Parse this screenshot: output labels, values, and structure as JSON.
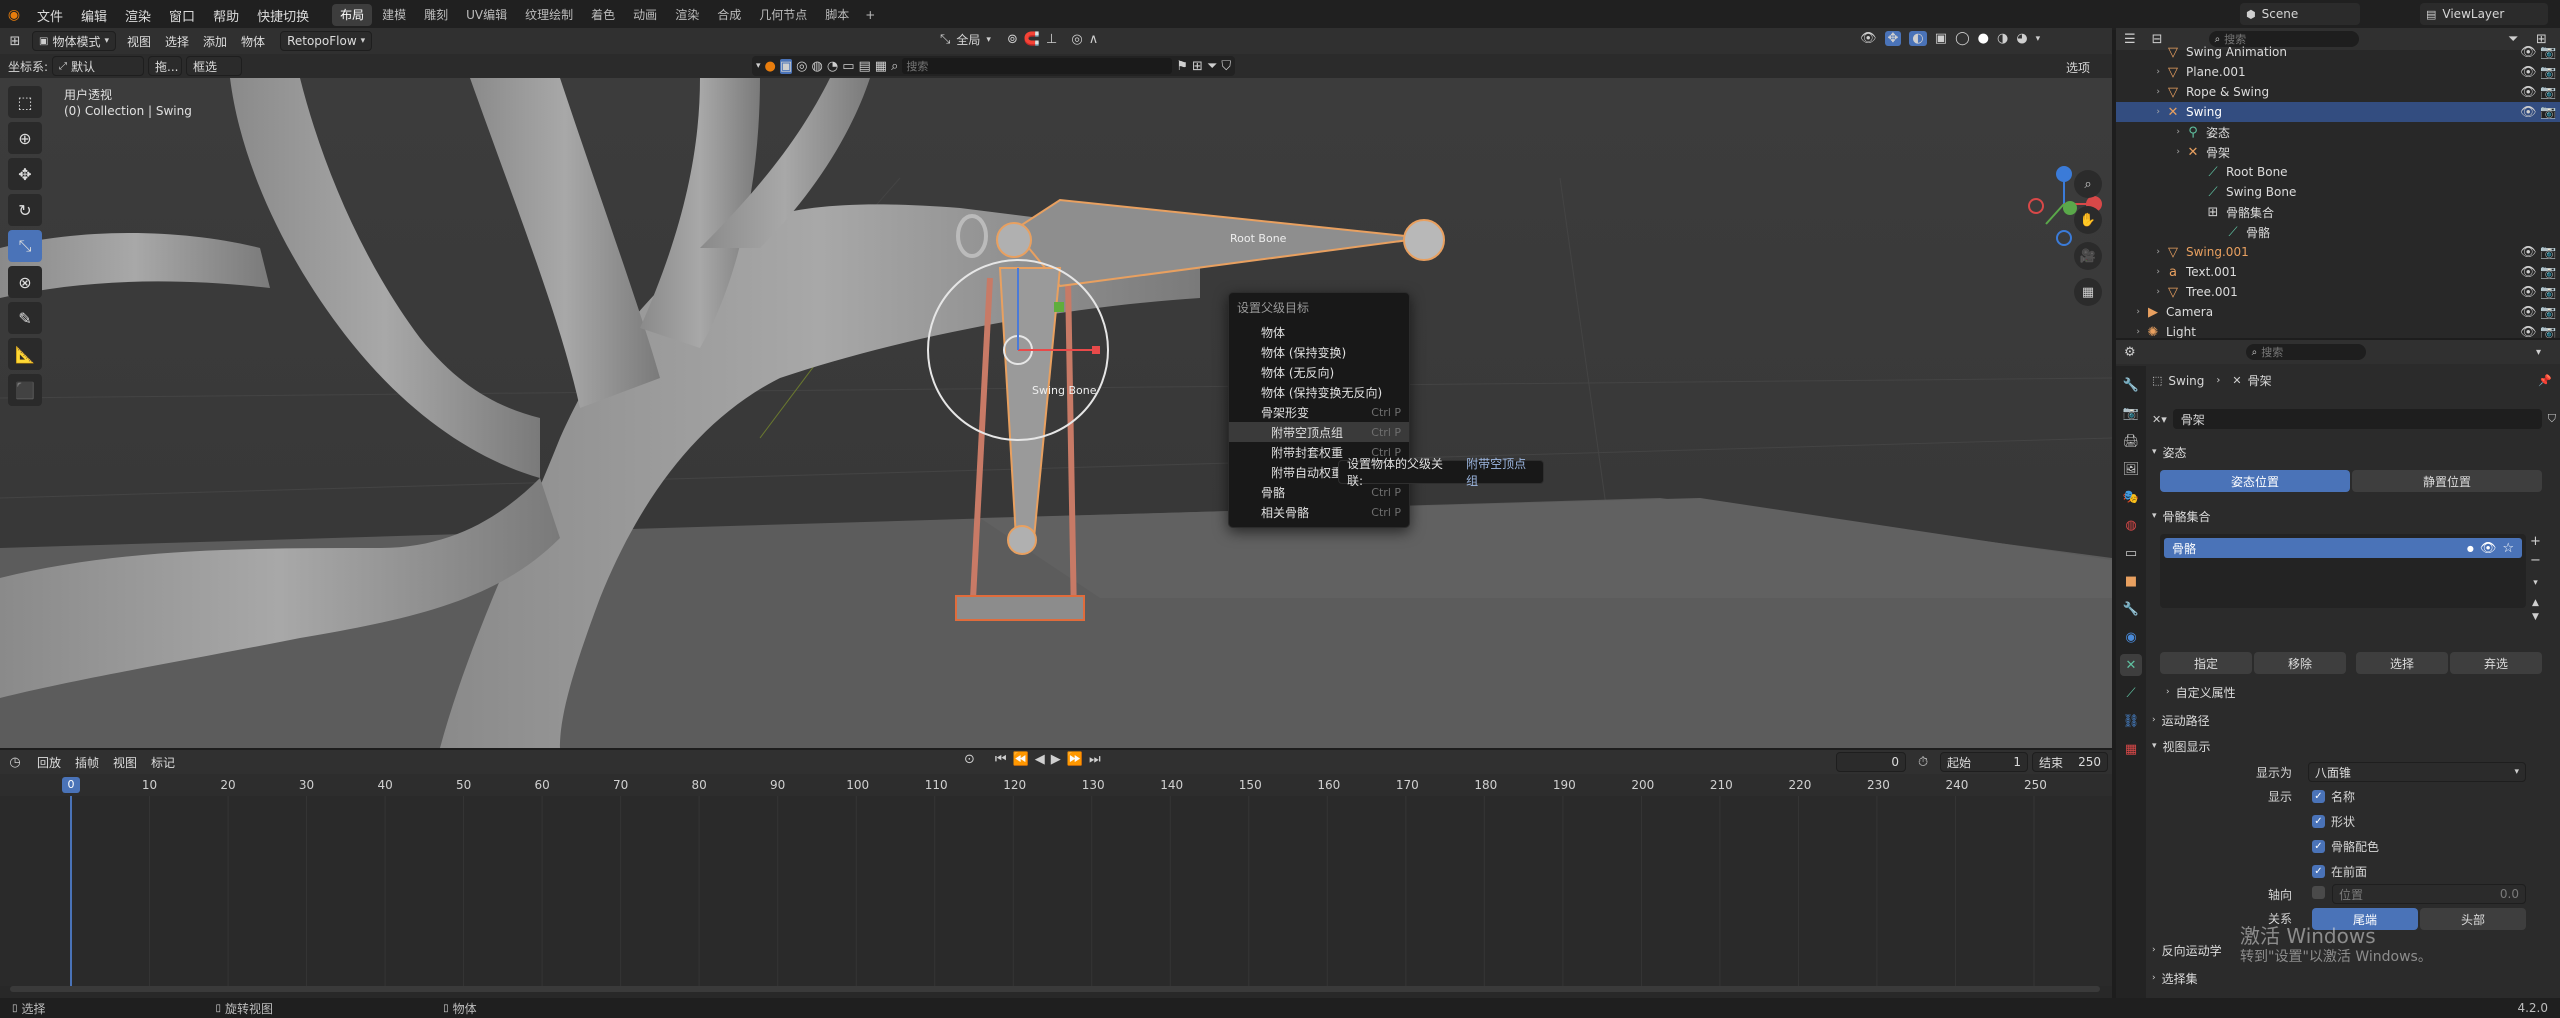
{
  "topbar": {
    "menus": [
      "文件",
      "编辑",
      "渲染",
      "窗口",
      "帮助",
      "快捷切换"
    ],
    "workspaces": [
      "布局",
      "建模",
      "雕刻",
      "UV编辑",
      "纹理绘制",
      "着色",
      "动画",
      "渲染",
      "合成",
      "几何节点",
      "脚本"
    ],
    "active_workspace": "布局",
    "add_tab": "+",
    "scene": "Scene",
    "view_layer": "ViewLayer"
  },
  "vp_header": {
    "mode": "物体模式",
    "menus": [
      "视图",
      "选择",
      "添加",
      "物体"
    ],
    "retopo": "RetopoFlow",
    "pivot": "全局",
    "options": "选项"
  },
  "vp_header2": {
    "coord_label": "坐标系:",
    "coord_value": "默认",
    "drag_label": "拖...",
    "select_box": "框选",
    "search_placeholder": "搜索"
  },
  "viewport": {
    "view_name": "用户透视",
    "collection": "(0) Collection | Swing",
    "bone_label_root": "Root Bone",
    "bone_label_swing": "Swing Bone"
  },
  "context_menu": {
    "title": "设置父级目标",
    "items": [
      {
        "label": "物体",
        "shortcut": ""
      },
      {
        "label": "物体 (保持变换)",
        "shortcut": ""
      },
      {
        "label": "物体 (无反向)",
        "shortcut": ""
      },
      {
        "label": "物体 (保持变换无反向)",
        "shortcut": ""
      },
      {
        "label": "骨架形变",
        "shortcut": "Ctrl P"
      },
      {
        "label": "附带空顶点组",
        "shortcut": "Ctrl P"
      },
      {
        "label": "附带封套权重",
        "shortcut": "Ctrl P"
      },
      {
        "label": "附带自动权重",
        "shortcut": ""
      },
      {
        "label": "骨骼",
        "shortcut": "Ctrl P"
      },
      {
        "label": "相关骨骼",
        "shortcut": "Ctrl P"
      }
    ]
  },
  "tooltip": {
    "label": "设置物体的父级关联:",
    "value": "附带空顶点组"
  },
  "timeline": {
    "menus": [
      "回放",
      "插帧",
      "视图",
      "标记"
    ],
    "current_frame": "0",
    "start_label": "起始",
    "start_value": "1",
    "end_label": "结束",
    "end_value": "250",
    "playhead": "0",
    "ticks": [
      "10",
      "20",
      "30",
      "40",
      "50",
      "60",
      "70",
      "80",
      "90",
      "100",
      "110",
      "120",
      "130",
      "140",
      "150",
      "160",
      "170",
      "180",
      "190",
      "200",
      "210",
      "220",
      "230",
      "240",
      "250"
    ]
  },
  "statusbar": {
    "items": [
      "选择",
      "旋转视图",
      "物体"
    ],
    "version": "4.2.0"
  },
  "outliner": {
    "search_placeholder": "搜索",
    "rows": [
      {
        "label": "Swing Animation",
        "indent": 2,
        "icon": "object-icon",
        "selected": false,
        "color": "#dcdcdc"
      },
      {
        "label": "Plane.001",
        "indent": 2,
        "icon": "mesh-icon",
        "selected": false,
        "color": "#dcdcdc"
      },
      {
        "label": "Rope & Swing",
        "indent": 2,
        "icon": "mesh-icon",
        "selected": false,
        "color": "#dcdcdc"
      },
      {
        "label": "Swing",
        "indent": 2,
        "icon": "armature-icon",
        "selected": true,
        "color": "#ffffff"
      },
      {
        "label": "姿态",
        "indent": 3,
        "icon": "pose-icon",
        "selected": false,
        "color": "#dcdcdc"
      },
      {
        "label": "骨架",
        "indent": 3,
        "icon": "armature-icon",
        "selected": false,
        "color": "#dcdcdc"
      },
      {
        "label": "Root Bone",
        "indent": 4,
        "icon": "bone-icon",
        "selected": false,
        "color": "#dcdcdc"
      },
      {
        "label": "Swing Bone",
        "indent": 4,
        "icon": "bone-icon",
        "selected": false,
        "color": "#dcdcdc"
      },
      {
        "label": "骨骼集合",
        "indent": 4,
        "icon": "bone-collection-icon",
        "selected": false,
        "color": "#dcdcdc"
      },
      {
        "label": "骨骼",
        "indent": 5,
        "icon": "bone-icon",
        "selected": false,
        "color": "#dcdcdc"
      },
      {
        "label": "Swing.001",
        "indent": 2,
        "icon": "mesh-icon",
        "selected": false,
        "color": "#e8a060"
      },
      {
        "label": "Text.001",
        "indent": 2,
        "icon": "text-icon",
        "selected": false,
        "color": "#dcdcdc"
      },
      {
        "label": "Tree.001",
        "indent": 2,
        "icon": "mesh-icon",
        "selected": false,
        "color": "#dcdcdc"
      },
      {
        "label": "Camera",
        "indent": 1,
        "icon": "camera-icon",
        "selected": false,
        "color": "#dcdcdc"
      },
      {
        "label": "Light",
        "indent": 1,
        "icon": "light-icon",
        "selected": false,
        "color": "#dcdcdc"
      }
    ]
  },
  "properties": {
    "search_placeholder": "搜索",
    "breadcrumb_object": "Swing",
    "breadcrumb_data": "骨架",
    "data_name": "骨架",
    "pose_section": "姿态",
    "pose_position": "姿态位置",
    "rest_position": "静置位置",
    "bone_collections_section": "骨骼集合",
    "collection_item": "骨骼",
    "assign": "指定",
    "remove": "移除",
    "select": "选择",
    "deselect": "弃选",
    "custom_props": "自定义属性",
    "motion_paths": "运动路径",
    "viewport_display": "视图显示",
    "display_as_label": "显示为",
    "display_as_value": "八面锥",
    "show_label": "显示",
    "show_names": "名称",
    "show_shapes": "形状",
    "show_colors": "骨骼配色",
    "in_front": "在前面",
    "axes_label": "轴向",
    "axes_position": "位置",
    "axes_value": "0.0",
    "relations_label": "关系",
    "relations_tail": "尾端",
    "relations_head": "头部",
    "ik_section": "反向运动学",
    "selection_sets": "选择集"
  },
  "watermark": {
    "line1": "激活 Windows",
    "line2": "转到\"设置\"以激活 Windows。"
  },
  "colors": {
    "accent": "#4a73b8",
    "selected_row": "#334d80",
    "orange": "#e8a060"
  }
}
